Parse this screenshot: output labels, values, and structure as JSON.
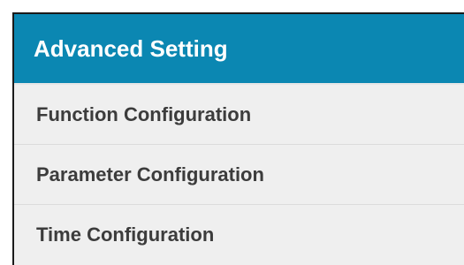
{
  "panel": {
    "title": "Advanced Setting",
    "items": [
      {
        "label": "Function Configuration"
      },
      {
        "label": "Parameter Configuration"
      },
      {
        "label": "Time Configuration"
      }
    ]
  },
  "colors": {
    "header_background": "#0b87b2",
    "header_text": "#ffffff",
    "menu_background": "#efefef",
    "menu_text": "#3c3c3c"
  }
}
